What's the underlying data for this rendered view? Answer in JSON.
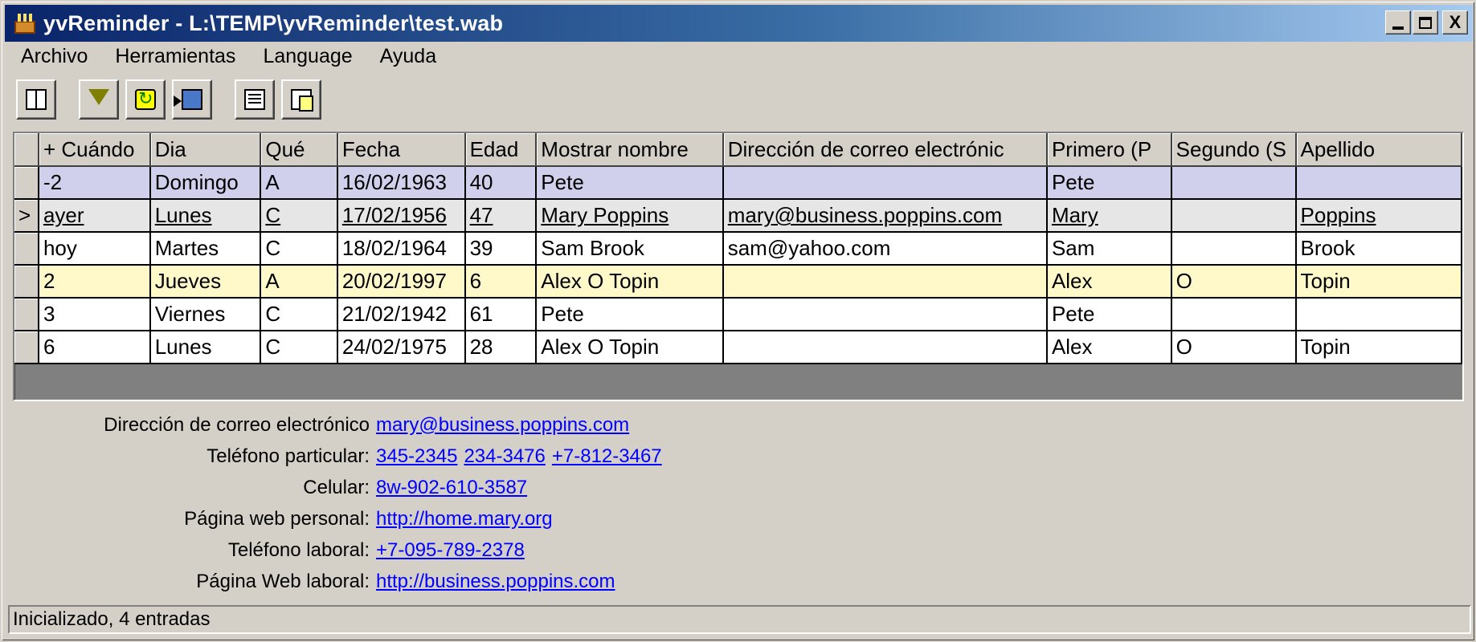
{
  "window": {
    "title": "yvReminder - L:\\TEMP\\yvReminder\\test.wab",
    "minimize_label": "_",
    "close_label": "X"
  },
  "menu": {
    "items": [
      {
        "label": "Archivo"
      },
      {
        "label": "Herramientas"
      },
      {
        "label": "Language"
      },
      {
        "label": "Ayuda"
      }
    ]
  },
  "toolbar": {
    "buttons": [
      {
        "icon": "address-book-icon"
      },
      {
        "icon": "filter-edit-icon"
      },
      {
        "icon": "refresh-icon"
      },
      {
        "icon": "export-icon"
      },
      {
        "icon": "properties-icon"
      },
      {
        "icon": "copy-icon"
      }
    ]
  },
  "grid": {
    "columns": [
      "+ Cuándo",
      "Dia",
      "Qué",
      "Fecha",
      "Edad",
      "Mostrar nombre",
      "Dirección de correo electrónic",
      "Primero (P",
      "Segundo (S",
      "Apellido"
    ],
    "rows": [
      {
        "indicator": "",
        "cells": [
          "-2",
          "Domingo",
          "A",
          "16/02/1963",
          "40",
          "Pete",
          "",
          "Pete",
          "",
          ""
        ]
      },
      {
        "indicator": ">",
        "cells": [
          "ayer",
          "Lunes",
          "C",
          "17/02/1956",
          "47",
          "Mary Poppins",
          "mary@business.poppins.com",
          "Mary",
          "",
          "Poppins"
        ]
      },
      {
        "indicator": "",
        "cells": [
          "hoy",
          "Martes",
          "C",
          "18/02/1964",
          "39",
          "Sam Brook",
          "sam@yahoo.com",
          "Sam",
          "",
          "Brook"
        ]
      },
      {
        "indicator": "",
        "cells": [
          "2",
          "Jueves",
          "A",
          "20/02/1997",
          "6",
          "Alex O Topin",
          "",
          "Alex",
          "O",
          "Topin"
        ]
      },
      {
        "indicator": "",
        "cells": [
          "3",
          "Viernes",
          "C",
          "21/02/1942",
          "61",
          "Pete",
          "",
          "Pete",
          "",
          ""
        ]
      },
      {
        "indicator": "",
        "cells": [
          "6",
          "Lunes",
          "C",
          "24/02/1975",
          "28",
          "Alex O Topin",
          "",
          "Alex",
          "O",
          "Topin"
        ]
      }
    ],
    "row_colors": {
      "purple": "#d0d0ec",
      "current": "#e6e6e6",
      "yellow": "#fff8c8",
      "normal": "#ffffff"
    }
  },
  "details": {
    "email_label": "Dirección de correo electrónico",
    "email": "mary@business.poppins.com",
    "home_phone_label": "Teléfono particular:",
    "home_phones": [
      "345-2345",
      "234-3476",
      "+7-812-3467"
    ],
    "mobile_label": "Celular:",
    "mobile": "8w-902-610-3587",
    "personal_web_label": "Página web personal:",
    "personal_web": "http://home.mary.org",
    "work_phone_label": "Teléfono laboral:",
    "work_phone": "+7-095-789-2378",
    "work_web_label": "Página Web laboral:",
    "work_web": "http://business.poppins.com"
  },
  "status": {
    "text": "Inicializado, 4 entradas"
  }
}
